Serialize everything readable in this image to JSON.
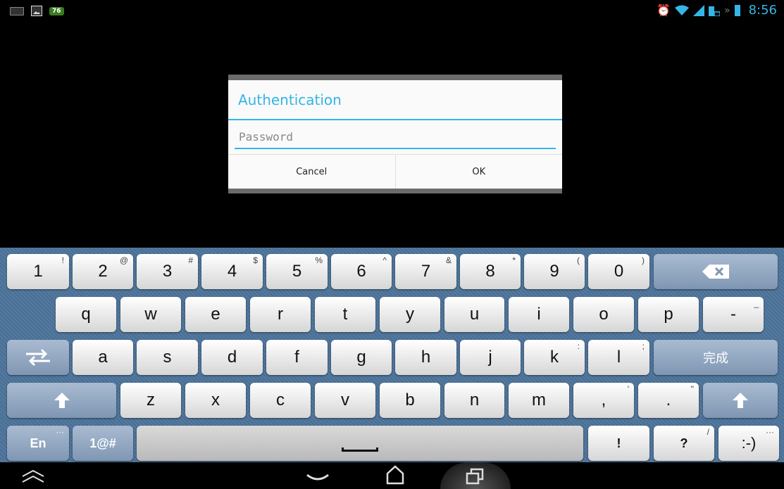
{
  "status_bar": {
    "left_badge": "76",
    "time": "8:56",
    "icons": [
      "keyboard-icon",
      "image-icon",
      "alarm-icon",
      "wifi-icon",
      "signal-icon",
      "battery-icon"
    ]
  },
  "dialog": {
    "title": "Authentication",
    "password_placeholder": "Password",
    "cancel_label": "Cancel",
    "ok_label": "OK"
  },
  "keyboard": {
    "row1": [
      {
        "main": "1",
        "sub": "!"
      },
      {
        "main": "2",
        "sub": "@"
      },
      {
        "main": "3",
        "sub": "#"
      },
      {
        "main": "4",
        "sub": "$"
      },
      {
        "main": "5",
        "sub": "%"
      },
      {
        "main": "6",
        "sub": "^"
      },
      {
        "main": "7",
        "sub": "&"
      },
      {
        "main": "8",
        "sub": "*"
      },
      {
        "main": "9",
        "sub": "("
      },
      {
        "main": "0",
        "sub": ")"
      }
    ],
    "row2": [
      {
        "main": "q",
        "sub": ""
      },
      {
        "main": "w",
        "sub": ""
      },
      {
        "main": "e",
        "sub": ""
      },
      {
        "main": "r",
        "sub": ""
      },
      {
        "main": "t",
        "sub": ""
      },
      {
        "main": "y",
        "sub": ""
      },
      {
        "main": "u",
        "sub": ""
      },
      {
        "main": "i",
        "sub": ""
      },
      {
        "main": "o",
        "sub": ""
      },
      {
        "main": "p",
        "sub": ""
      },
      {
        "main": "-",
        "sub": "_"
      }
    ],
    "row3": [
      {
        "main": "a",
        "sub": ""
      },
      {
        "main": "s",
        "sub": ""
      },
      {
        "main": "d",
        "sub": ""
      },
      {
        "main": "f",
        "sub": ""
      },
      {
        "main": "g",
        "sub": ""
      },
      {
        "main": "h",
        "sub": ""
      },
      {
        "main": "j",
        "sub": ""
      },
      {
        "main": "k",
        "sub": ":"
      },
      {
        "main": "l",
        "sub": ";"
      }
    ],
    "row4": [
      {
        "main": "z",
        "sub": ""
      },
      {
        "main": "x",
        "sub": ""
      },
      {
        "main": "c",
        "sub": ""
      },
      {
        "main": "v",
        "sub": ""
      },
      {
        "main": "b",
        "sub": ""
      },
      {
        "main": "n",
        "sub": ""
      },
      {
        "main": "m",
        "sub": ""
      },
      {
        "main": ",",
        "sub": "'"
      },
      {
        "main": ".",
        "sub": "\""
      }
    ],
    "done_label": "完成",
    "lang_label": "En",
    "lang_sub": "···",
    "symbols_label": "1@#",
    "excl_label": "!",
    "question_label": "?",
    "question_sub": "/",
    "smiley_label": ":-)",
    "smiley_sub": "···"
  },
  "nav_bar": {
    "icons": [
      "keyboard-hide-icon",
      "back-icon",
      "home-icon",
      "recent-apps-icon"
    ]
  }
}
